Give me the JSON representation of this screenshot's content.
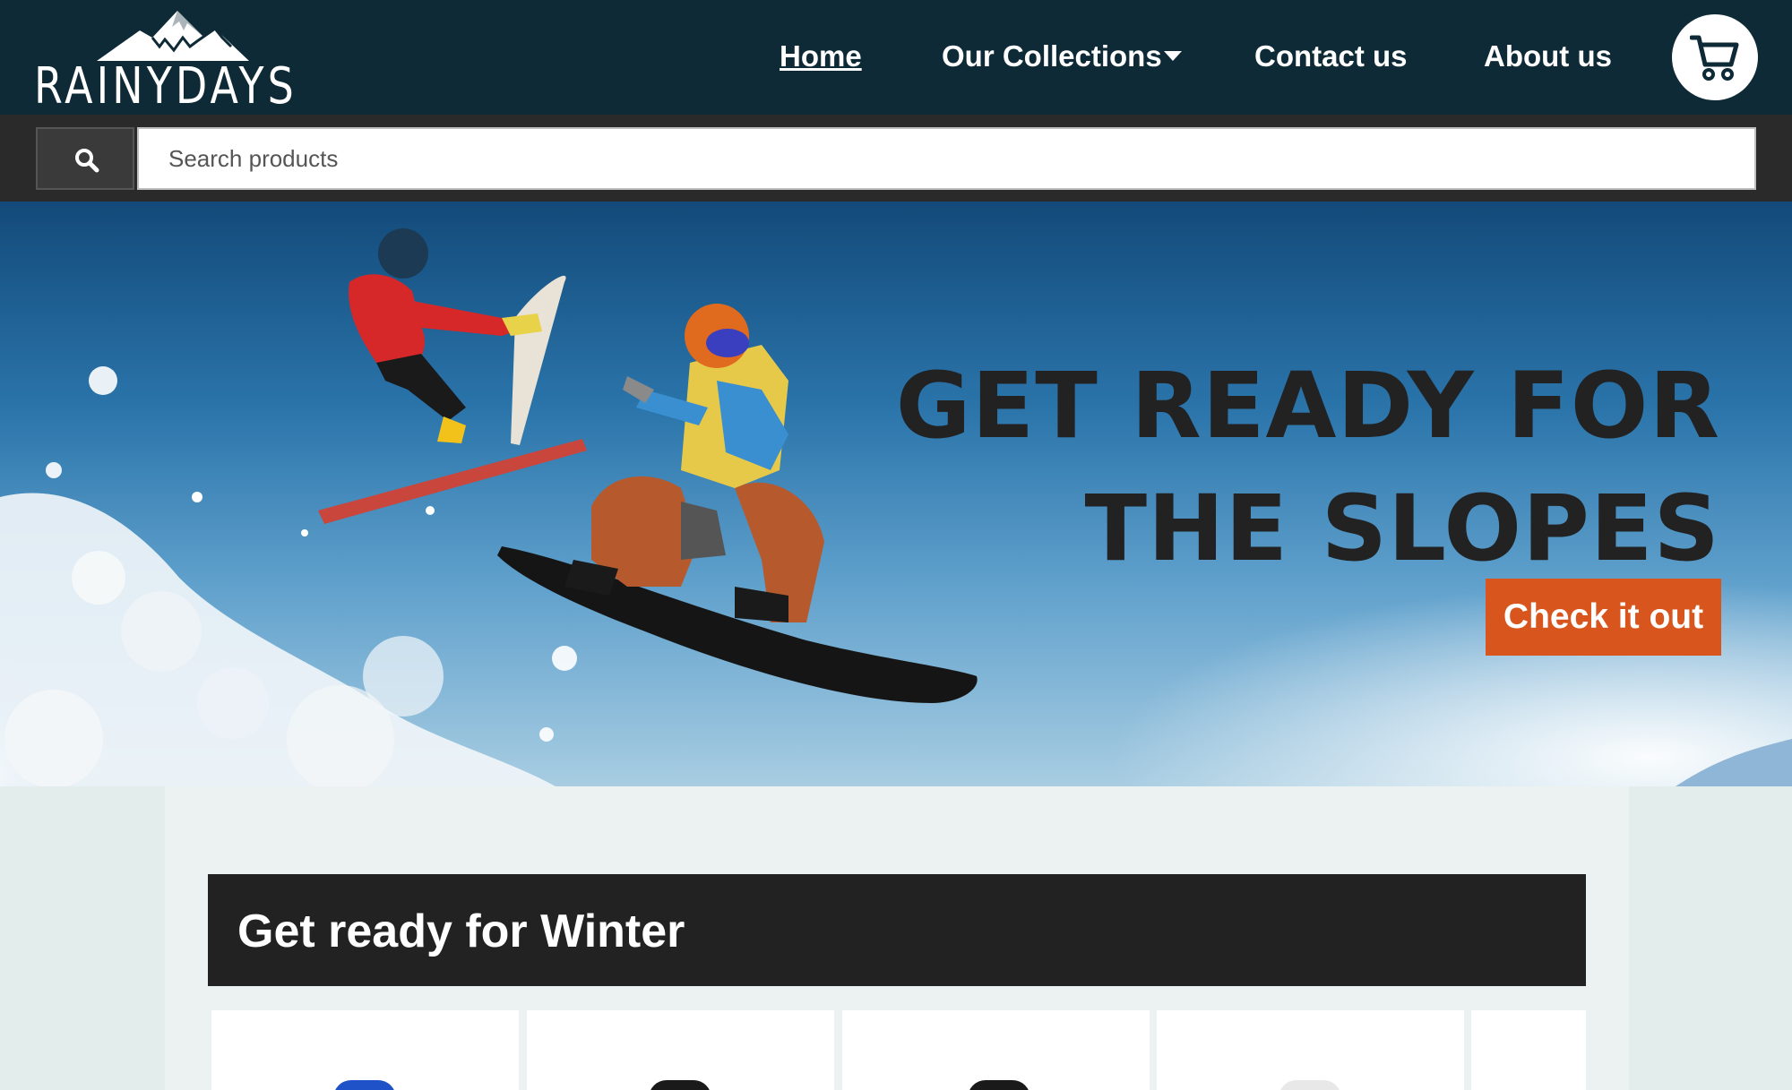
{
  "brand": {
    "name": "RAINYDAYS"
  },
  "nav": {
    "home": "Home",
    "collections": "Our Collections",
    "contact": "Contact us",
    "about": "About us"
  },
  "search": {
    "placeholder": "Search products"
  },
  "hero": {
    "title_line1": "GET READY FOR",
    "title_line2": "THE SLOPES",
    "cta": "Check it out"
  },
  "section": {
    "title": "Get ready for Winter"
  },
  "products": [
    {
      "color": "#1f52c9"
    },
    {
      "color": "#1a1a1a"
    },
    {
      "color": "#1a1a1a"
    },
    {
      "color": "#e8e8e8"
    }
  ],
  "icons": [
    "mountain-icon",
    "caret-down-icon",
    "cart-icon",
    "search-icon"
  ],
  "colors": {
    "header": "#0e2a36",
    "accent": "#d8561e",
    "section_bg": "#222222"
  }
}
